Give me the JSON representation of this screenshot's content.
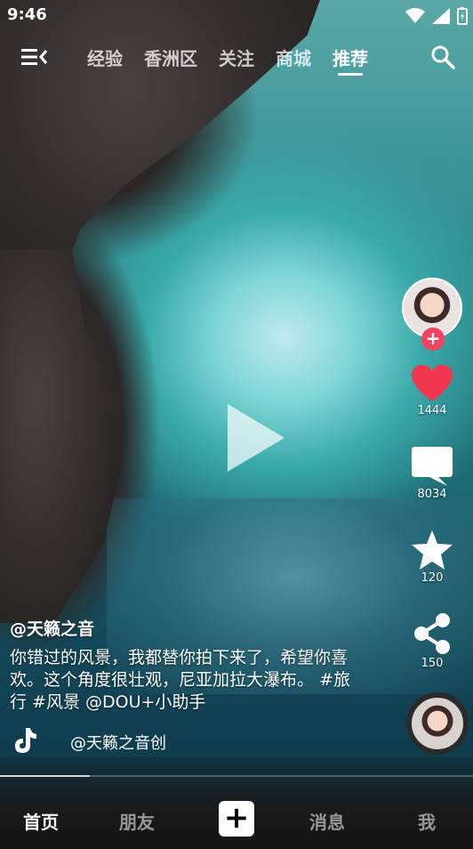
{
  "status_bar": {
    "time": "9:46"
  },
  "top_nav": {
    "tabs": [
      {
        "label": "经验"
      },
      {
        "label": "香洲区"
      },
      {
        "label": "关注"
      },
      {
        "label": "商城"
      },
      {
        "label": "推荐"
      }
    ],
    "active_tab": "推荐"
  },
  "right_rail": {
    "likes": "1444",
    "comments": "8034",
    "favorites": "120",
    "shares": "150",
    "like_color": "#f2364f",
    "follow_color": "#f44262"
  },
  "caption": {
    "author": "@天籁之音",
    "description": "你错过的风景，我都替你拍下来了，希望你喜欢。这个角度很壮观，尼亚加拉大瀑布。 #旅行 #风景 @DOU+小助手",
    "music": "@天籁之音创"
  },
  "progress": {
    "fraction": 0.19
  },
  "bottom_nav": {
    "home": "首页",
    "friends": "朋友",
    "add": "+",
    "messages": "消息",
    "me": "我"
  }
}
